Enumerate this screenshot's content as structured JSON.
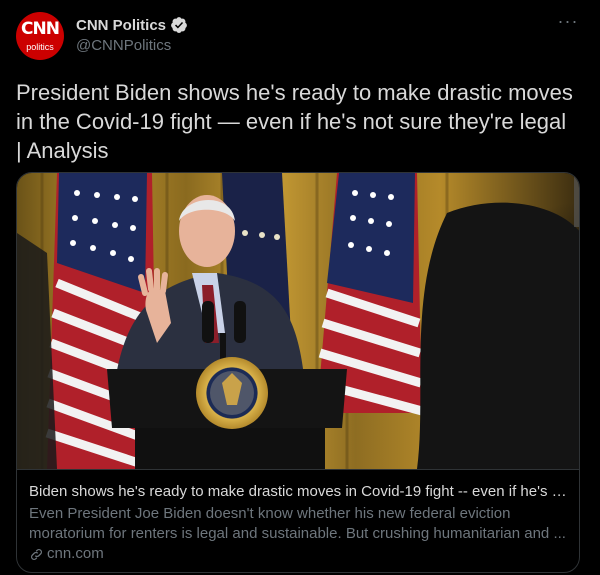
{
  "account": {
    "display_name": "CNN Politics",
    "handle": "@CNNPolitics",
    "avatar_logo": "CNN",
    "avatar_sub": "politics",
    "brand_color": "#cc0000",
    "verified_color": "#d9d9d9"
  },
  "menu": {
    "more_icon": "more-horizontal-icon",
    "more_glyph": "···"
  },
  "tweet": {
    "text": "President Biden shows he's ready to make drastic moves in the Covid-19 fight — even if he's not sure they're legal | Analysis"
  },
  "card": {
    "image_icon": "podium-photo",
    "title": "Biden shows he's ready to make drastic moves in Covid-19 fight -- even if he's n...",
    "description": "Even President Joe Biden doesn't know whether his new federal eviction moratorium for renters is legal and sustainable. But crushing humanitarian and ...",
    "domain": "cnn.com",
    "domain_icon": "link-icon"
  },
  "colors": {
    "background": "#000000",
    "text": "#d9d9d9",
    "secondary_text": "#6e767d",
    "border": "#2f3336"
  }
}
